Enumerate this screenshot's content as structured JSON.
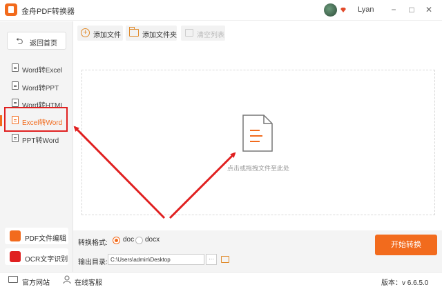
{
  "window": {
    "title": "金舟PDF转换器",
    "username": "Lyan",
    "minimize": "−",
    "maximize": "□",
    "close": "✕"
  },
  "sidebar": {
    "home_label": "返回首页",
    "items": [
      {
        "label": "Word转Excel"
      },
      {
        "label": "Word转PPT"
      },
      {
        "label": "Word转HTML"
      },
      {
        "label": "Excel转Word"
      },
      {
        "label": "PPT转Word"
      }
    ],
    "tools": [
      {
        "label": "PDF文件编辑",
        "color": "#f26b1d"
      },
      {
        "label": "OCR文字识别",
        "color": "#e02020"
      }
    ]
  },
  "toolbar": {
    "add_file": "添加文件",
    "add_folder": "添加文件夹",
    "clear_list": "清空列表"
  },
  "dropzone": {
    "hint": "点击或拖拽文件至此处"
  },
  "settings": {
    "format_label": "转换格式:",
    "formats": [
      {
        "label": "doc",
        "selected": true
      },
      {
        "label": "docx",
        "selected": false
      }
    ],
    "output_label": "输出目录:",
    "output_path": "C:\\Users\\admin\\Desktop",
    "browse": "···",
    "start_label": "开始转换"
  },
  "statusbar": {
    "website": "官方网站",
    "support": "在线客服",
    "version": "版本：v 6.6.5.0"
  },
  "colors": {
    "accent": "#f26b1d",
    "annotation": "#e02020"
  }
}
